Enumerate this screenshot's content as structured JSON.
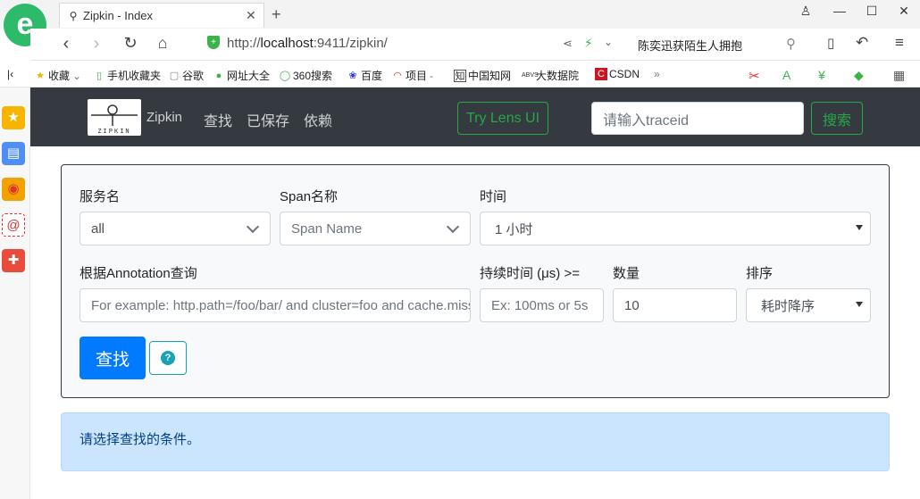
{
  "browser": {
    "tab_title": "Zipkin - Index",
    "url_prefix": "http://",
    "url_host": "localhost",
    "url_rest": ":9411/zipkin/",
    "right_search_text": "陈奕迅获陌生人拥抱",
    "bookmarks": [
      "收藏",
      "手机收藏夹",
      "谷歌",
      "网址大全",
      "360搜索",
      "百度",
      "项目",
      "中国知网",
      "大数据院",
      "CSDN"
    ]
  },
  "header": {
    "brand": "Zipkin",
    "logo_text": "ZIPKIN",
    "nav": [
      "查找",
      "已保存",
      "依赖"
    ],
    "lens_button": "Try Lens UI",
    "traceid_placeholder": "请输入traceid",
    "search_button": "搜索"
  },
  "form": {
    "service_label": "服务名",
    "service_value": "all",
    "span_label": "Span名称",
    "span_placeholder": "Span Name",
    "time_label": "时间",
    "time_value": "1 小时",
    "annotation_label": "根据Annotation查询",
    "annotation_placeholder": "For example: http.path=/foo/bar/ and cluster=foo and cache.miss",
    "duration_label": "持续时间 (μs) >=",
    "duration_placeholder": "Ex: 100ms or 5s",
    "limit_label": "数量",
    "limit_value": "10",
    "sort_label": "排序",
    "sort_value": "耗时降序",
    "find_button": "查找",
    "help_icon": "?"
  },
  "alert": {
    "message": "请选择查找的条件。"
  },
  "colors": {
    "navbar_bg": "#343a40",
    "success": "#28a745",
    "primary": "#007bff",
    "info": "#17a2b8",
    "alert_bg": "#cce5ff"
  }
}
